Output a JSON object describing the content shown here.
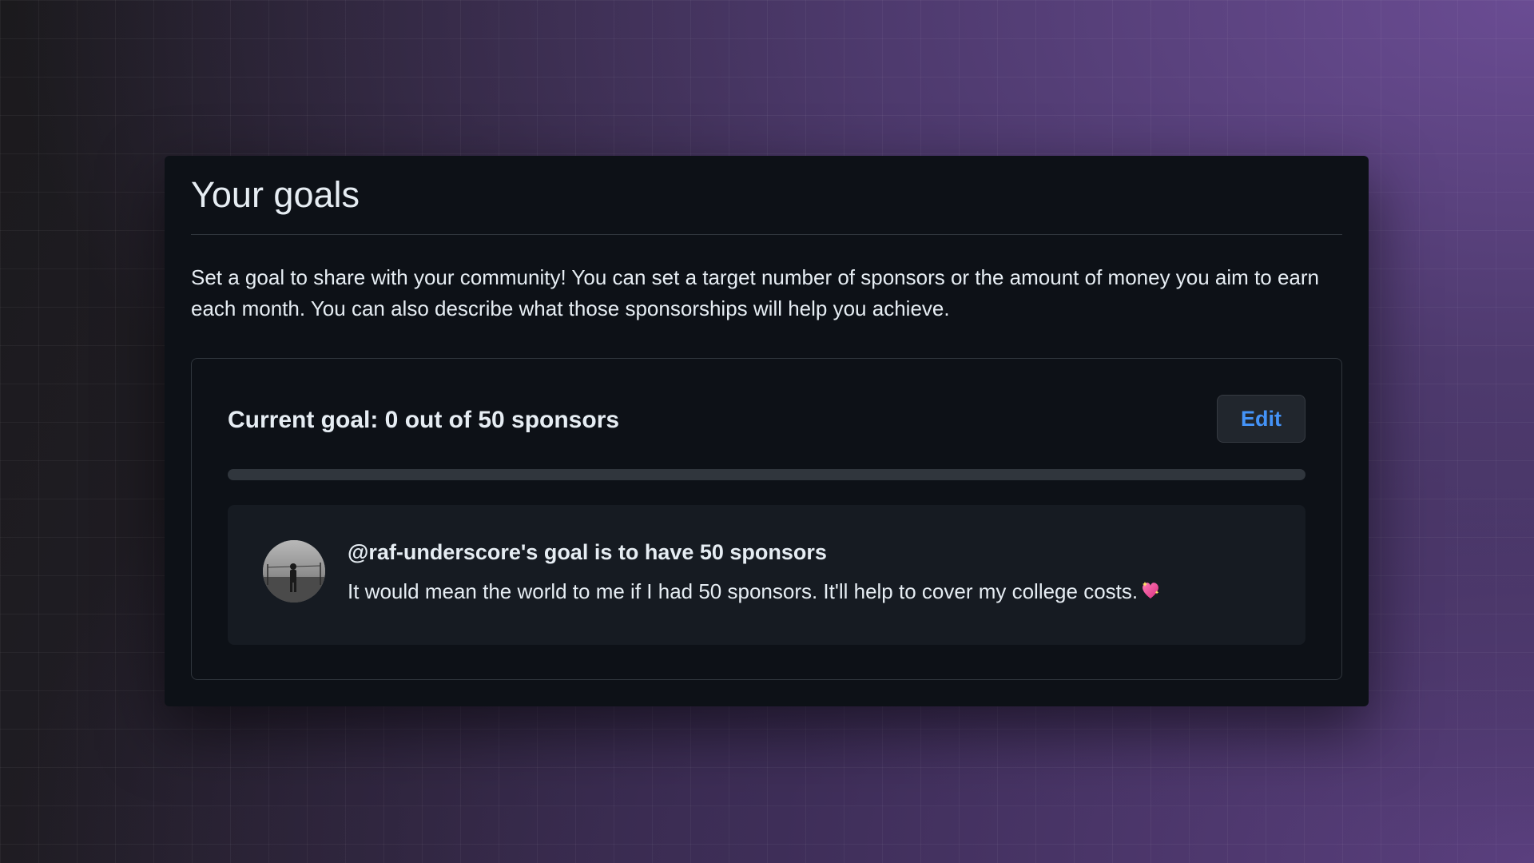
{
  "panel": {
    "title": "Your goals",
    "description": "Set a goal to share with your community! You can set a target number of sponsors or the amount of money you aim to earn each month. You can also describe what those sponsorships will help you achieve."
  },
  "goal": {
    "title": "Current goal: 0 out of 50 sponsors",
    "edit_label": "Edit",
    "progress_percent": 0,
    "current": 0,
    "target": 50
  },
  "card": {
    "heading": "@raf-underscore's goal is to have 50 sponsors",
    "text": "It would mean the world to me if I had 50 sponsors. It'll help to cover my college costs.",
    "emoji_icon": "sparkling-heart-icon"
  },
  "colors": {
    "accent_link": "#4493f8",
    "panel_bg": "#0d1117",
    "card_bg": "#161b22",
    "border": "#30363d"
  }
}
